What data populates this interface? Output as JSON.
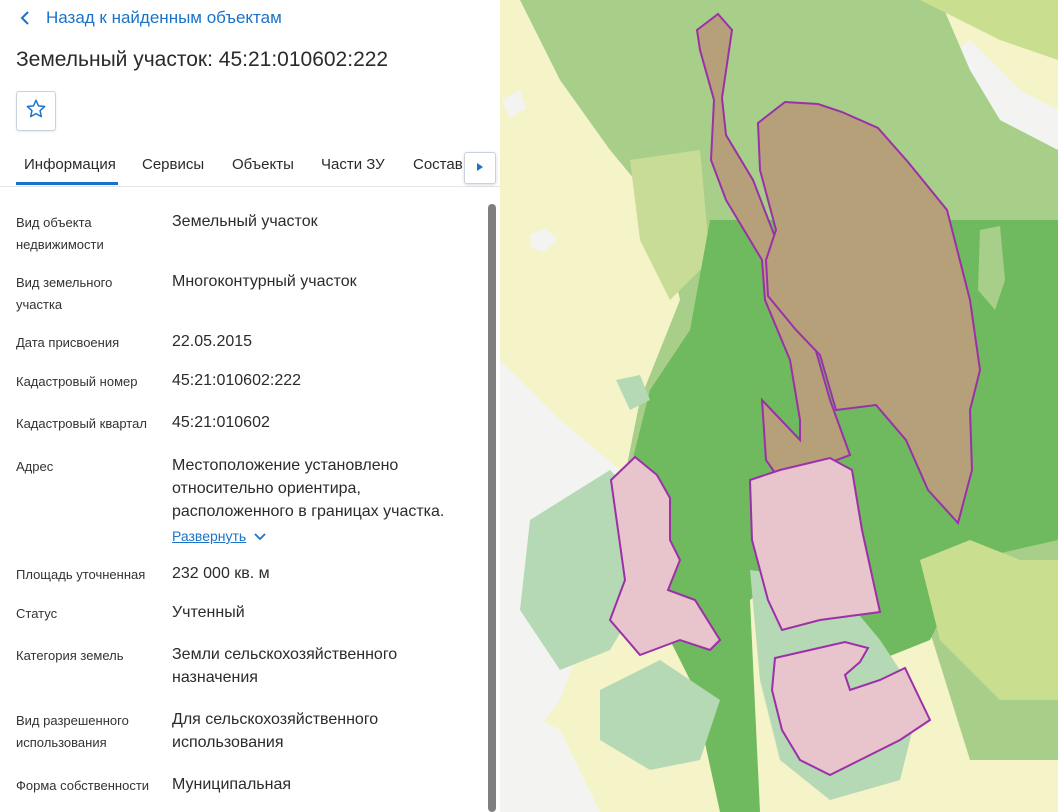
{
  "back_link": "Назад к найденным объектам",
  "title": "Земельный участок: 45:21:010602:222",
  "tabs": [
    {
      "label": "Информация",
      "active": true
    },
    {
      "label": "Сервисы",
      "active": false
    },
    {
      "label": "Объекты",
      "active": false
    },
    {
      "label": "Части ЗУ",
      "active": false
    },
    {
      "label": "Состав",
      "active": false
    }
  ],
  "properties": [
    {
      "label": "Вид объекта недвижимости",
      "value": "Земельный участок"
    },
    {
      "label": "Вид земельного участка",
      "value": "Многоконтурный участок"
    },
    {
      "label": "Дата присвоения",
      "value": "22.05.2015"
    },
    {
      "label": "Кадастровый номер",
      "value": "45:21:010602:222"
    },
    {
      "label": "Кадастровый квартал",
      "value": "45:21:010602"
    },
    {
      "label": "Адрес",
      "value": "Местоположение установлено относительно ориентира, расположенного в границах участка.",
      "expand": "Развернуть"
    },
    {
      "label": "Площадь уточненная",
      "value": "232 000 кв. м"
    },
    {
      "label": "Статус",
      "value": "Учтенный"
    },
    {
      "label": "Категория земель",
      "value": "Земли сельскохозяйственного назначения"
    },
    {
      "label": "Вид разрешенного использования",
      "value": "Для сельскохозяйственного использования"
    },
    {
      "label": "Форма собственности",
      "value": "Муниципальная"
    }
  ],
  "icons": {
    "back": "chevron-left-icon",
    "favorite": "star-outline-icon",
    "tabs_more": "triangle-right-icon",
    "expand": "chevron-down-icon"
  },
  "colors": {
    "accent": "#1a73c9",
    "parcel_border": "#9b30a8",
    "parcel_fill": "#b89a7c",
    "parcel_pink": "#e8c4cc",
    "forest_dark": "#6fba5e",
    "forest_light": "#a8cf8a",
    "field_yellow": "#f5f3c8",
    "meadow": "#b5d9b4"
  }
}
